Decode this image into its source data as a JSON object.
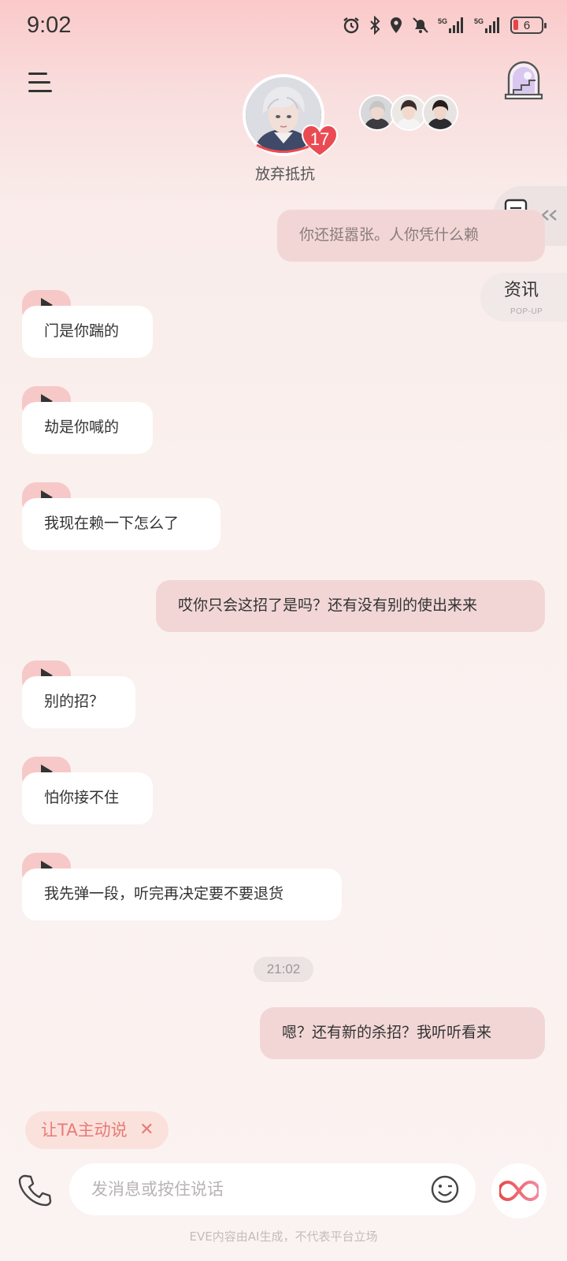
{
  "status_bar": {
    "time": "9:02",
    "battery_level": "6",
    "icons": [
      "alarm-icon",
      "bluetooth-icon",
      "location-icon",
      "mute-bell-icon",
      "signal-5g-icon",
      "signal-5g-icon",
      "battery-icon"
    ]
  },
  "header": {
    "character_name": "放弃抵抗",
    "affinity_level": "17",
    "menu_icon": "menu-icon",
    "window_icon": "window-icon"
  },
  "side": {
    "news_label": "资讯",
    "news_sub": "POP-UP",
    "doc_icon": "document-check-icon"
  },
  "messages": [
    {
      "side": "right",
      "text": "你还挺嚣张。人你凭什么赖"
    },
    {
      "side": "left",
      "voice": true,
      "text": "门是你踹的"
    },
    {
      "side": "left",
      "voice": true,
      "text": "劫是你喊的"
    },
    {
      "side": "left",
      "voice": true,
      "text": "我现在赖一下怎么了"
    },
    {
      "side": "right",
      "text": "哎你只会这招了是吗？还有没有别的使出来来"
    },
    {
      "side": "left",
      "voice": true,
      "text": "别的招？"
    },
    {
      "side": "left",
      "voice": true,
      "text": "怕你接不住"
    },
    {
      "side": "left",
      "voice": true,
      "text": "我先弹一段，听完再决定要不要退货"
    },
    {
      "side": "right",
      "text": "嗯？还有新的杀招？我听听看来"
    }
  ],
  "timestamp": "21:02",
  "composer": {
    "suggest_chip": "让TA主动说",
    "suggest_close": "✕",
    "placeholder": "发消息或按住说话"
  },
  "footer_note": "EVE内容由AI生成，不代表平台立场",
  "colors": {
    "user_bubble": "#f2d6d6",
    "bot_bubble": "#ffffff",
    "voice_tab": "#f7c8c8",
    "accent_red": "#e84a4a"
  }
}
